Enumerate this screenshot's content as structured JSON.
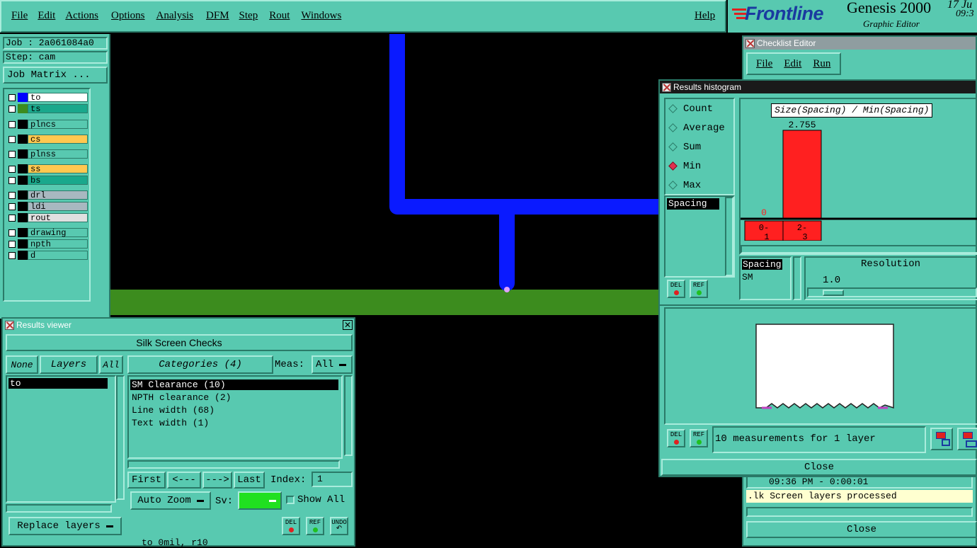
{
  "menu": [
    "File",
    "Edit",
    "Actions",
    "Options",
    "Analysis",
    "DFM",
    "Step",
    "Rout",
    "Windows"
  ],
  "help": "Help",
  "brand": {
    "logo": "Frontline",
    "product": "Genesis 2000",
    "subtitle": "Graphic Editor",
    "date": "17 Ju",
    "time": "09:3"
  },
  "job": {
    "job_label": "Job : 2a061084a0",
    "step_label": "Step: cam",
    "matrix_button": "Job Matrix ..."
  },
  "layers": [
    {
      "name": "to",
      "swatch": "#0000ff",
      "bg": "#ffffff"
    },
    {
      "name": "ts",
      "swatch": "#3c8c1e",
      "bg": "#1aa88c"
    },
    {
      "name": "plncs",
      "swatch": "#000000",
      "bg": "#58c9b0"
    },
    {
      "name": "cs",
      "swatch": "#000000",
      "bg": "#ffc850"
    },
    {
      "name": "plnss",
      "swatch": "#000000",
      "bg": "#58c9b0"
    },
    {
      "name": "ss",
      "swatch": "#000000",
      "bg": "#ffc850"
    },
    {
      "name": "bs",
      "swatch": "#000000",
      "bg": "#1aa88c"
    },
    {
      "name": "drl",
      "swatch": "#000000",
      "bg": "#a8b8c0"
    },
    {
      "name": "ldi",
      "swatch": "#000000",
      "bg": "#a8b8c0"
    },
    {
      "name": "rout",
      "swatch": "#000000",
      "bg": "#e0e0e0"
    },
    {
      "name": "drawing",
      "swatch": "#000000",
      "bg": "#58c9b0"
    },
    {
      "name": "npth",
      "swatch": "#000000",
      "bg": "#58c9b0"
    },
    {
      "name": "d",
      "swatch": "#000000",
      "bg": "#58c9b0"
    }
  ],
  "results_viewer": {
    "title": "Results viewer",
    "header": "Silk Screen Checks",
    "none_btn": "None",
    "layers_btn": "Layers",
    "all_btn": "All",
    "categories_btn": "Categories (4)",
    "meas_label": "Meas:",
    "meas_value": "All",
    "layer_items": [
      "to"
    ],
    "categories": [
      "SM Clearance (10)",
      "NPTH clearance (2)",
      "Line width (68)",
      "Text width (1)"
    ],
    "nav": {
      "first": "First",
      "prev": "<---",
      "next": "--->",
      "last": "Last",
      "index_label": "Index:",
      "index_value": "1"
    },
    "auto_zoom": "Auto Zoom",
    "sv_label": "Sv:",
    "show_all": "Show All",
    "replace_layers": "Replace layers",
    "del": "DEL",
    "ref": "REF",
    "undo": "UNDO",
    "status": "to 0mil, r10"
  },
  "checklist": {
    "title": "Checklist Editor",
    "menu": [
      "File",
      "Edit",
      "Run"
    ],
    "log_time": "09:36 PM - 0:00:01",
    "log_msg": ".lk Screen layers processed",
    "close": "Close"
  },
  "histogram": {
    "title": "Results histogram",
    "modes": [
      "Count",
      "Average",
      "Sum",
      "Min",
      "Max"
    ],
    "selected_mode": "Min",
    "chart_title": "Size(Spacing) / Min(Spacing)",
    "list_item": "Spacing",
    "list2": [
      "Spacing",
      "SM"
    ],
    "resolution_label": "Resolution",
    "resolution_value": "1.0",
    "status": "10 measurements for 1 layer",
    "del": "DEL",
    "ref": "REF",
    "close": "Close",
    "accent": "#ff2020"
  },
  "chart_data": {
    "type": "bar",
    "categories": [
      "0-1",
      "2-3"
    ],
    "values": [
      0,
      2.755
    ],
    "value_labels": [
      "0",
      "2.755"
    ],
    "title": "Size(Spacing) / Min(Spacing)",
    "xlabel": "",
    "ylabel": ""
  }
}
